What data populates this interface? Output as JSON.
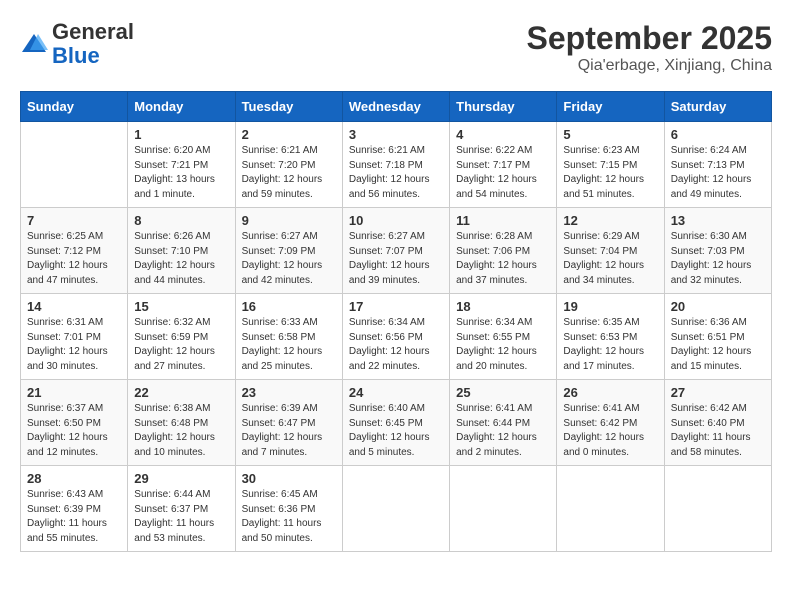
{
  "header": {
    "logo_general": "General",
    "logo_blue": "Blue",
    "month_title": "September 2025",
    "location": "Qia'erbage, Xinjiang, China"
  },
  "calendar": {
    "days_of_week": [
      "Sunday",
      "Monday",
      "Tuesday",
      "Wednesday",
      "Thursday",
      "Friday",
      "Saturday"
    ],
    "weeks": [
      [
        {
          "day": "",
          "info": ""
        },
        {
          "day": "1",
          "info": "Sunrise: 6:20 AM\nSunset: 7:21 PM\nDaylight: 13 hours\nand 1 minute."
        },
        {
          "day": "2",
          "info": "Sunrise: 6:21 AM\nSunset: 7:20 PM\nDaylight: 12 hours\nand 59 minutes."
        },
        {
          "day": "3",
          "info": "Sunrise: 6:21 AM\nSunset: 7:18 PM\nDaylight: 12 hours\nand 56 minutes."
        },
        {
          "day": "4",
          "info": "Sunrise: 6:22 AM\nSunset: 7:17 PM\nDaylight: 12 hours\nand 54 minutes."
        },
        {
          "day": "5",
          "info": "Sunrise: 6:23 AM\nSunset: 7:15 PM\nDaylight: 12 hours\nand 51 minutes."
        },
        {
          "day": "6",
          "info": "Sunrise: 6:24 AM\nSunset: 7:13 PM\nDaylight: 12 hours\nand 49 minutes."
        }
      ],
      [
        {
          "day": "7",
          "info": "Sunrise: 6:25 AM\nSunset: 7:12 PM\nDaylight: 12 hours\nand 47 minutes."
        },
        {
          "day": "8",
          "info": "Sunrise: 6:26 AM\nSunset: 7:10 PM\nDaylight: 12 hours\nand 44 minutes."
        },
        {
          "day": "9",
          "info": "Sunrise: 6:27 AM\nSunset: 7:09 PM\nDaylight: 12 hours\nand 42 minutes."
        },
        {
          "day": "10",
          "info": "Sunrise: 6:27 AM\nSunset: 7:07 PM\nDaylight: 12 hours\nand 39 minutes."
        },
        {
          "day": "11",
          "info": "Sunrise: 6:28 AM\nSunset: 7:06 PM\nDaylight: 12 hours\nand 37 minutes."
        },
        {
          "day": "12",
          "info": "Sunrise: 6:29 AM\nSunset: 7:04 PM\nDaylight: 12 hours\nand 34 minutes."
        },
        {
          "day": "13",
          "info": "Sunrise: 6:30 AM\nSunset: 7:03 PM\nDaylight: 12 hours\nand 32 minutes."
        }
      ],
      [
        {
          "day": "14",
          "info": "Sunrise: 6:31 AM\nSunset: 7:01 PM\nDaylight: 12 hours\nand 30 minutes."
        },
        {
          "day": "15",
          "info": "Sunrise: 6:32 AM\nSunset: 6:59 PM\nDaylight: 12 hours\nand 27 minutes."
        },
        {
          "day": "16",
          "info": "Sunrise: 6:33 AM\nSunset: 6:58 PM\nDaylight: 12 hours\nand 25 minutes."
        },
        {
          "day": "17",
          "info": "Sunrise: 6:34 AM\nSunset: 6:56 PM\nDaylight: 12 hours\nand 22 minutes."
        },
        {
          "day": "18",
          "info": "Sunrise: 6:34 AM\nSunset: 6:55 PM\nDaylight: 12 hours\nand 20 minutes."
        },
        {
          "day": "19",
          "info": "Sunrise: 6:35 AM\nSunset: 6:53 PM\nDaylight: 12 hours\nand 17 minutes."
        },
        {
          "day": "20",
          "info": "Sunrise: 6:36 AM\nSunset: 6:51 PM\nDaylight: 12 hours\nand 15 minutes."
        }
      ],
      [
        {
          "day": "21",
          "info": "Sunrise: 6:37 AM\nSunset: 6:50 PM\nDaylight: 12 hours\nand 12 minutes."
        },
        {
          "day": "22",
          "info": "Sunrise: 6:38 AM\nSunset: 6:48 PM\nDaylight: 12 hours\nand 10 minutes."
        },
        {
          "day": "23",
          "info": "Sunrise: 6:39 AM\nSunset: 6:47 PM\nDaylight: 12 hours\nand 7 minutes."
        },
        {
          "day": "24",
          "info": "Sunrise: 6:40 AM\nSunset: 6:45 PM\nDaylight: 12 hours\nand 5 minutes."
        },
        {
          "day": "25",
          "info": "Sunrise: 6:41 AM\nSunset: 6:44 PM\nDaylight: 12 hours\nand 2 minutes."
        },
        {
          "day": "26",
          "info": "Sunrise: 6:41 AM\nSunset: 6:42 PM\nDaylight: 12 hours\nand 0 minutes."
        },
        {
          "day": "27",
          "info": "Sunrise: 6:42 AM\nSunset: 6:40 PM\nDaylight: 11 hours\nand 58 minutes."
        }
      ],
      [
        {
          "day": "28",
          "info": "Sunrise: 6:43 AM\nSunset: 6:39 PM\nDaylight: 11 hours\nand 55 minutes."
        },
        {
          "day": "29",
          "info": "Sunrise: 6:44 AM\nSunset: 6:37 PM\nDaylight: 11 hours\nand 53 minutes."
        },
        {
          "day": "30",
          "info": "Sunrise: 6:45 AM\nSunset: 6:36 PM\nDaylight: 11 hours\nand 50 minutes."
        },
        {
          "day": "",
          "info": ""
        },
        {
          "day": "",
          "info": ""
        },
        {
          "day": "",
          "info": ""
        },
        {
          "day": "",
          "info": ""
        }
      ]
    ]
  }
}
